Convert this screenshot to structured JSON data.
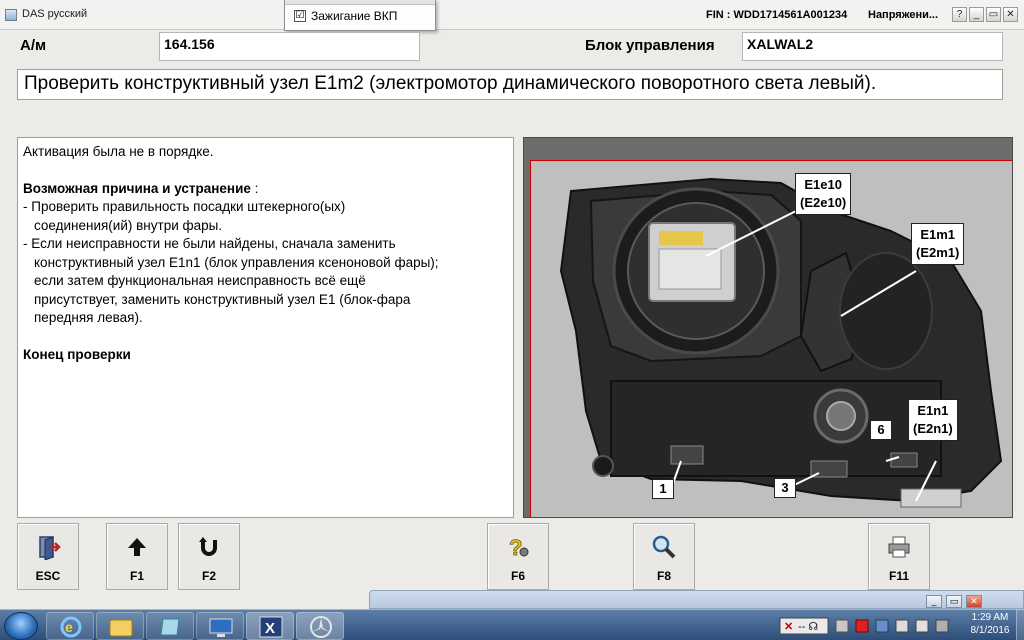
{
  "window": {
    "title": "DAS русский",
    "fin": "FIN : WDD1714561A001234",
    "voltage": "Напряжени...",
    "controls": {
      "help": "?",
      "minimize": "_",
      "restore": "▭",
      "close": "✕"
    }
  },
  "ignition": {
    "checked": true,
    "check_glyph": "☑",
    "label": "Зажигание ВКП"
  },
  "header": {
    "am_label": "А/м",
    "am_value": "164.156",
    "ecu_label": "Блок управления",
    "ecu_value": "XALWAL2"
  },
  "instruction": "Проверить конструктивный узел E1m2 (электромотор динамического поворотного света левый).",
  "text_panel": {
    "line1": "Активация была не в порядке.",
    "cause_heading": "Возможная причина и устранение",
    "cause_suffix": " :",
    "item1_line1": "- Проверить правильность посадки штекерного(ых)",
    "item1_line2": "соединения(ий) внутри фары.",
    "item2_line1": "- Если неисправности не были найдены, сначала заменить",
    "item2_line2": "конструктивный узел E1n1 (блок управления ксеноновой фары);",
    "item2_line3": "если затем функциональная неисправность всё ещё",
    "item2_line4": "присутствует, заменить конструктивный узел E1 (блок-фара",
    "item2_line5": "передняя левая).",
    "end": "Конец проверки"
  },
  "image_callouts": {
    "e1e10": {
      "line1": "E1e10",
      "line2": "(E2e10)"
    },
    "e1m1": {
      "line1": "E1m1",
      "line2": "(E2m1)"
    },
    "e1n1": {
      "line1": "E1n1",
      "line2": "(E2n1)"
    },
    "n1": "1",
    "n3": "3",
    "n6": "6"
  },
  "fkeys": {
    "esc": {
      "label": "ESC",
      "icon": "exit-door-icon"
    },
    "f1": {
      "label": "F1",
      "icon": "arrow-up-icon"
    },
    "f2": {
      "label": "F2",
      "icon": "u-turn-icon"
    },
    "f6": {
      "label": "F6",
      "icon": "help-question-icon"
    },
    "f8": {
      "label": "F8",
      "icon": "magnifier-icon"
    },
    "f11": {
      "label": "F11",
      "icon": "printer-icon"
    }
  },
  "taskbar": {
    "apps": [
      "internet-explorer-icon",
      "explorer-folder-icon",
      "notepad-icon",
      "remote-desktop-icon",
      "xentry-icon",
      "mercedes-star-icon"
    ],
    "time": "1:29 AM",
    "date": "8/1/2016"
  },
  "colors": {
    "accent_red": "#cc0000",
    "taskbar": "#3a5d8a"
  }
}
